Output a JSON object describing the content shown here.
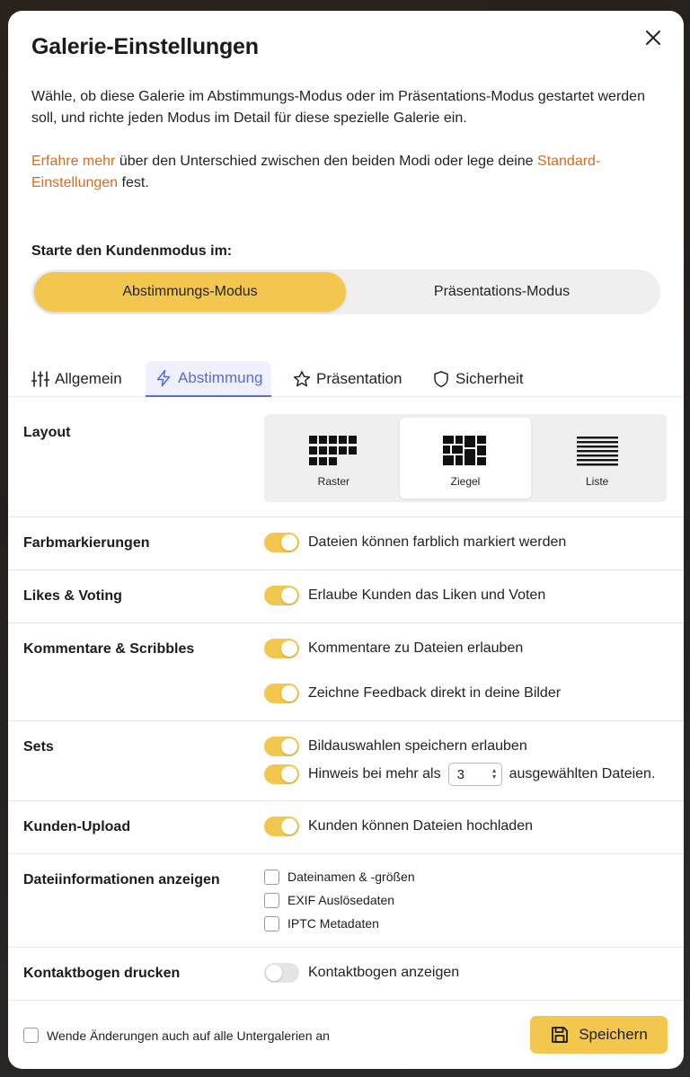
{
  "dialog": {
    "title": "Galerie-Einstellungen",
    "intro_text": "Wähle, ob diese Galerie im Abstimmungs-Modus oder im Präsentations-Modus gestartet werden soll, und richte jeden Modus im Detail für diese spezielle Galerie ein.",
    "learn_link": "Erfahre mehr",
    "learn_text_mid": " über den Unterschied zwischen den beiden Modi oder lege deine ",
    "defaults_link": "Standard-Einstellungen",
    "learn_text_end": " fest."
  },
  "start_mode": {
    "label": "Starte den Kundenmodus im:",
    "options": [
      "Abstimmungs-Modus",
      "Präsentations-Modus"
    ],
    "selected": "Abstimmungs-Modus"
  },
  "tabs": [
    {
      "label": "Allgemein",
      "icon": "sliders-icon"
    },
    {
      "label": "Abstimmung",
      "icon": "lightning-icon",
      "active": true
    },
    {
      "label": "Präsentation",
      "icon": "star-icon"
    },
    {
      "label": "Sicherheit",
      "icon": "shield-icon"
    }
  ],
  "settings": {
    "layout": {
      "label": "Layout",
      "options": [
        "Raster",
        "Ziegel",
        "Liste"
      ],
      "selected": "Ziegel"
    },
    "color_marks": {
      "label": "Farbmarkierungen",
      "toggle_text": "Dateien können farblich markiert werden",
      "on": true
    },
    "likes": {
      "label": "Likes & Voting",
      "toggle_text": "Erlaube Kunden das Liken und Voten",
      "on": true
    },
    "comments": {
      "label": "Kommentare & Scribbles",
      "toggle1_text": "Kommentare zu Dateien erlauben",
      "toggle2_text": "Zeichne Feedback direkt in deine Bilder"
    },
    "sets": {
      "label": "Sets",
      "toggle1_text": "Bildauswahlen speichern erlauben",
      "hint_prefix": "Hinweis bei mehr als",
      "hint_value": "3",
      "hint_suffix": "ausgewählten Dateien."
    },
    "upload": {
      "label": "Kunden-Upload",
      "toggle_text": "Kunden können Dateien hochladen",
      "on": true
    },
    "file_info": {
      "label": "Dateiinformationen anzeigen",
      "options": [
        "Dateinamen & -größen",
        "EXIF Auslösedaten",
        "IPTC Metadaten"
      ]
    },
    "contact_sheet": {
      "label": "Kontaktbogen drucken",
      "toggle_text": "Kontaktbogen anzeigen",
      "on": false
    }
  },
  "footer": {
    "apply_subgalleries": "Wende Änderungen auch auf alle Untergalerien an",
    "save_label": "Speichern"
  },
  "colors": {
    "accent": "#f3c74d",
    "link": "#d96a1c",
    "tab_active": "#5a6bd6"
  }
}
